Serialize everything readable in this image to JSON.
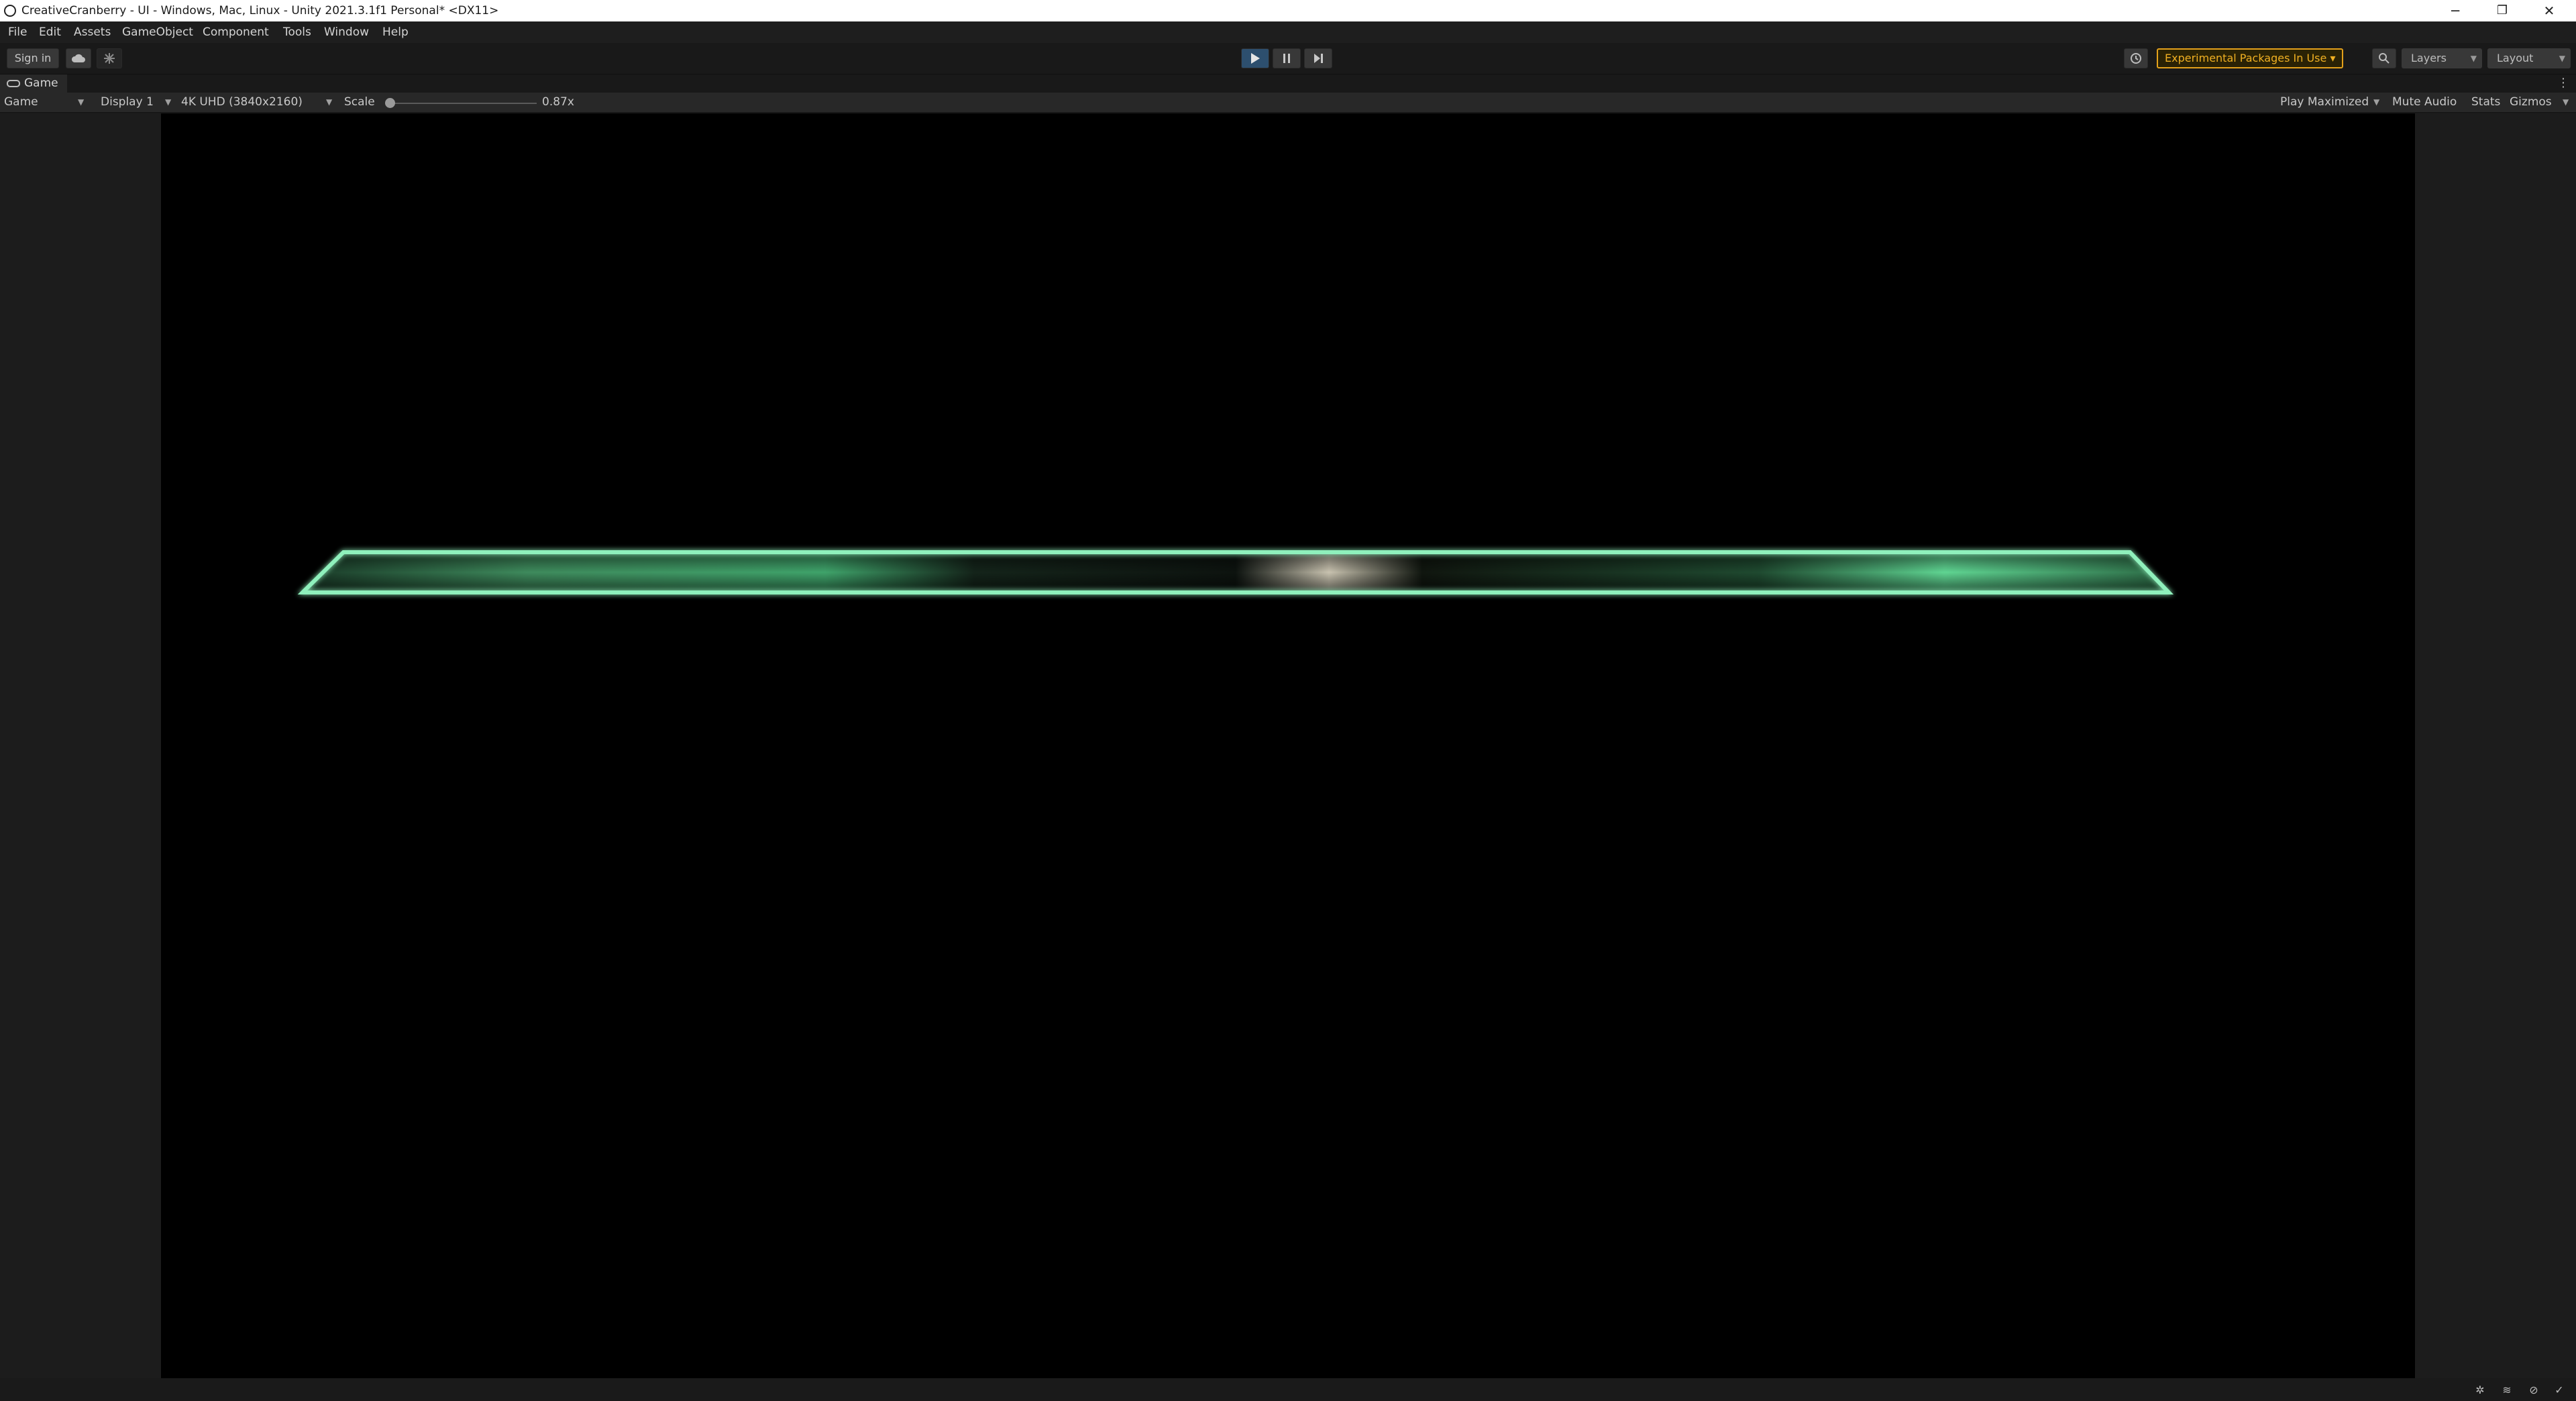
{
  "window": {
    "title": "CreativeCranberry - UI - Windows, Mac, Linux - Unity 2021.3.1f1 Personal* <DX11>",
    "minimize_glyph": "─",
    "restore_glyph": "❐",
    "close_glyph": "✕"
  },
  "menu": {
    "items": [
      "File",
      "Edit",
      "Assets",
      "GameObject",
      "Component",
      "Tools",
      "Window",
      "Help"
    ]
  },
  "toolbar": {
    "sign_in_label": "Sign in",
    "experimental_label": "Experimental Packages In Use ▾",
    "layers_label": "Layers",
    "layout_label": "Layout",
    "play_state": "playing",
    "accent_color": "#e4a11b"
  },
  "game_tab": {
    "label": "Game"
  },
  "game_toolbar": {
    "view_select": "Game",
    "display_select": "Display 1",
    "resolution_select": "4K UHD (3840x2160)",
    "scale_label": "Scale",
    "scale_value": "0.87x",
    "play_maximized_label": "Play Maximized",
    "mute_audio_label": "Mute Audio",
    "stats_label": "Stats",
    "gizmos_label": "Gizmos"
  },
  "game_canvas": {
    "bar_color": "#6fe0a4",
    "glow_color": "#3fbf7a"
  }
}
